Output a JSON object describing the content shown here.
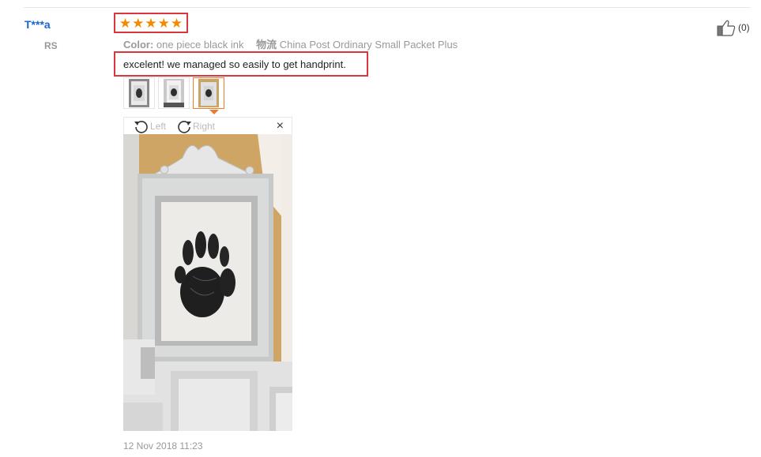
{
  "review": {
    "username": "T***a",
    "country": "RS",
    "rating": 5,
    "attributes": {
      "color_label": "Color:",
      "color_value": "one piece black ink",
      "shipping_label": "物流",
      "shipping_value": "China Post Ordinary Small Packet Plus"
    },
    "text": "excelent! we managed so easily to get handprint.",
    "datetime": "12 Nov 2018 11:23",
    "helpful": {
      "count_label": "(0)",
      "icon": "thumbs-up-icon"
    }
  },
  "viewer": {
    "rotate_left_label": "Left",
    "rotate_right_label": "Right",
    "close_glyph": "×",
    "thumbnail_count": 3,
    "selected_thumbnail": 3
  },
  "colors": {
    "username": "#1b66c9",
    "star": "#f58a00",
    "highlight_box": "#d9363e",
    "active_thumb": "#f07c2a"
  }
}
